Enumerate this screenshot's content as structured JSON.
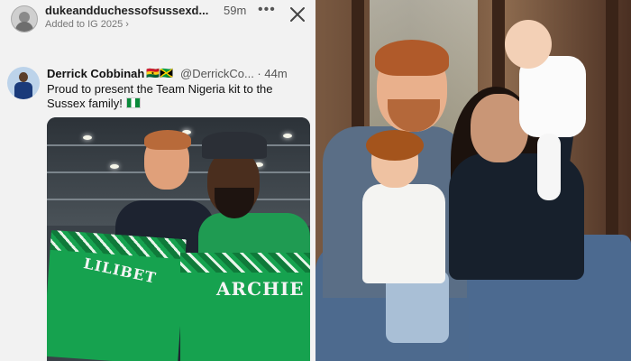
{
  "story": {
    "username": "dukeandduchessofsussexd...",
    "time": "59m",
    "added_to": "Added to IG 2025 ›",
    "more_label": "•••",
    "close_label": "Close"
  },
  "tweet": {
    "author": "Derrick Cobbinah",
    "flags": "🇬🇭🇯🇲",
    "handle_time": "@DerrickCo... · 44m",
    "text": "Proud to present the Team Nigeria kit to the Sussex family!"
  },
  "photo": {
    "jersey_left_text": "LILIBET",
    "jersey_right_text": "ARCHIE"
  },
  "colors": {
    "kit_green": "#16a24f",
    "background": "#f2f2f2"
  }
}
